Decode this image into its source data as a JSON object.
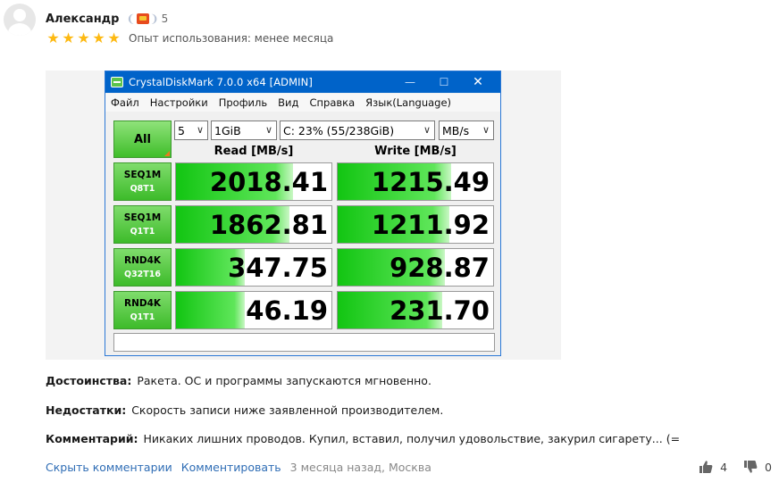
{
  "review": {
    "author": "Александр",
    "badge_count": "5",
    "rating_stars": 5,
    "experience": "Опыт использования: менее месяца",
    "pros_label": "Достоинства:",
    "pros_text": "Ракета. ОС и программы запускаются мгновенно.",
    "cons_label": "Недостатки:",
    "cons_text": "Скорость записи ниже заявленной производителем.",
    "comment_label": "Комментарий:",
    "comment_text": "Никаких лишних проводов. Купил, вставил, получил удовольствие, закурил сигарету... (=",
    "hide_comments": "Скрыть комментарии",
    "reply": "Комментировать",
    "meta": "3 месяца назад, Москва",
    "likes": "4",
    "dislikes": "0",
    "star_color": "#fdb912",
    "link_color": "#2f6db5"
  },
  "cdm": {
    "title": "CrystalDiskMark 7.0.0 x64 [ADMIN]",
    "menu": [
      "Файл",
      "Настройки",
      "Профиль",
      "Вид",
      "Справка",
      "Язык(Language)"
    ],
    "all_button": "All",
    "count": "5",
    "size": "1GiB",
    "drive": "C: 23% (55/238GiB)",
    "unit": "MB/s",
    "read_header": "Read [MB/s]",
    "write_header": "Write [MB/s]",
    "tests": [
      {
        "name": "SEQ1M",
        "sub": "Q8T1",
        "read": "2018.41",
        "write": "1215.49",
        "read_fill": 0.75,
        "write_fill": 0.73
      },
      {
        "name": "SEQ1M",
        "sub": "Q1T1",
        "read": "1862.81",
        "write": "1211.92",
        "read_fill": 0.73,
        "write_fill": 0.72
      },
      {
        "name": "RND4K",
        "sub": "Q32T16",
        "read": "347.75",
        "write": "928.87",
        "read_fill": 0.44,
        "write_fill": 0.69
      },
      {
        "name": "RND4K",
        "sub": "Q1T1",
        "read": "46.19",
        "write": "231.70",
        "read_fill": 0.44,
        "write_fill": 0.67
      }
    ],
    "accent_green": "#3fbe2a",
    "titlebar_blue": "#0063c9"
  }
}
